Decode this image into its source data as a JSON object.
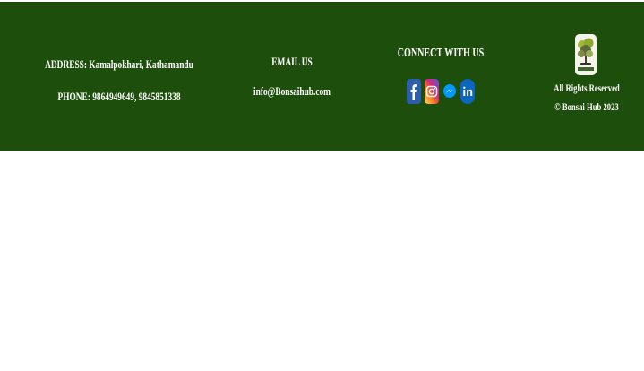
{
  "footer": {
    "address": "ADDRESS: Kamalpokhari, Kathamandu",
    "phone": "PHONE: 9864949649, 9845851338",
    "email_heading": "EMAIL US",
    "email": "info@Bonsaihub.com",
    "connect_heading": "CONNECT WITH US",
    "social": [
      {
        "icon": "facebook-icon",
        "color": "#1877f2"
      },
      {
        "icon": "instagram-icon",
        "color": "#e1306c"
      },
      {
        "icon": "messenger-icon",
        "color": "#0099ff"
      },
      {
        "icon": "linkedin-icon",
        "color": "#0a66c2"
      }
    ],
    "logo_icon": "bonsai-hub-logo",
    "rights": "All Rights Reserved",
    "copyright": "© Bonsai Hub 2023",
    "background": "#1d4e0b"
  }
}
